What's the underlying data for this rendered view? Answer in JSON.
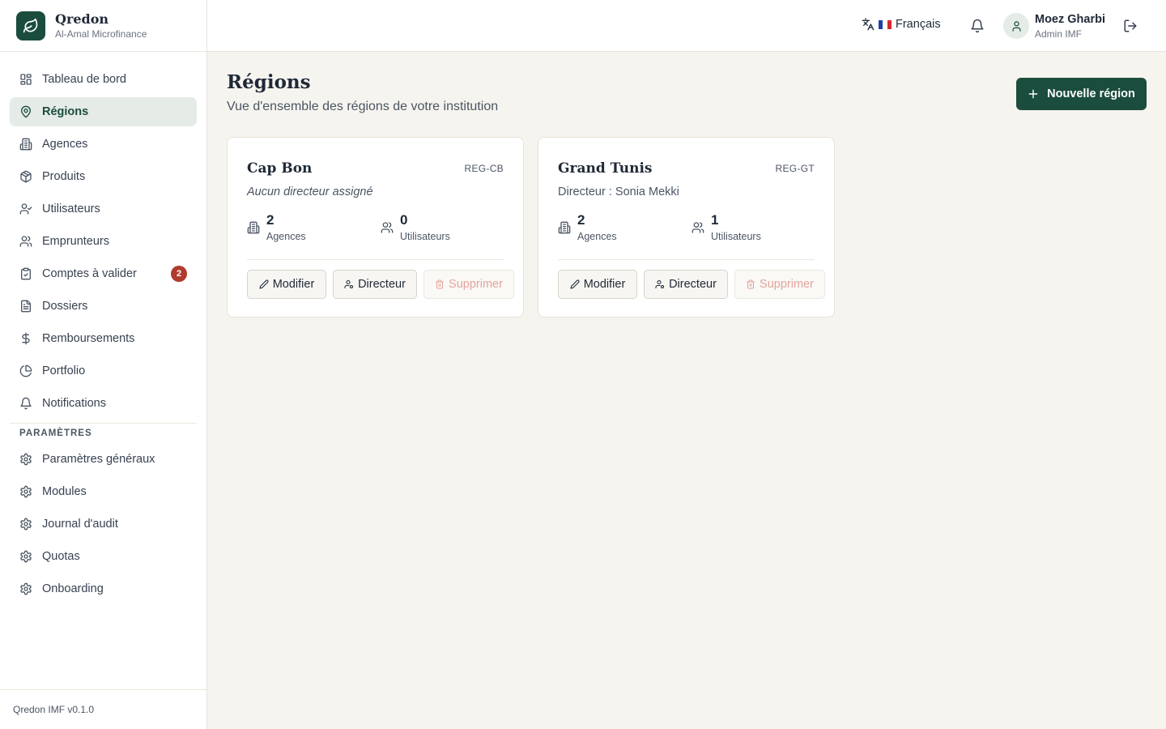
{
  "brand": {
    "name": "Qredon",
    "subtitle": "Al-Amal Microfinance"
  },
  "sidebar": {
    "items": [
      {
        "label": "Tableau de bord",
        "icon": "dashboard-icon"
      },
      {
        "label": "Régions",
        "icon": "map-pin-icon",
        "active": true
      },
      {
        "label": "Agences",
        "icon": "building-icon"
      },
      {
        "label": "Produits",
        "icon": "package-icon"
      },
      {
        "label": "Utilisateurs",
        "icon": "user-check-icon"
      },
      {
        "label": "Emprunteurs",
        "icon": "users-icon"
      },
      {
        "label": "Comptes à valider",
        "icon": "clipboard-icon",
        "badge": "2"
      },
      {
        "label": "Dossiers",
        "icon": "file-icon"
      },
      {
        "label": "Remboursements",
        "icon": "dollar-icon"
      },
      {
        "label": "Portfolio",
        "icon": "pie-chart-icon"
      },
      {
        "label": "Notifications",
        "icon": "bell-icon"
      }
    ],
    "settings_title": "PARAMÈTRES",
    "settings_items": [
      {
        "label": "Paramètres généraux",
        "icon": "gear-icon"
      },
      {
        "label": "Modules",
        "icon": "gear-icon"
      },
      {
        "label": "Journal d'audit",
        "icon": "gear-icon"
      },
      {
        "label": "Quotas",
        "icon": "gear-icon"
      },
      {
        "label": "Onboarding",
        "icon": "gear-icon"
      }
    ],
    "footer": "Qredon IMF v0.1.0"
  },
  "header": {
    "language": "Français",
    "user_name": "Moez Gharbi",
    "user_role": "Admin IMF"
  },
  "page": {
    "title": "Régions",
    "subtitle": "Vue d'ensemble des régions de votre institution",
    "new_button": "Nouvelle région"
  },
  "regions": [
    {
      "name": "Cap Bon",
      "code": "REG-CB",
      "director": "Aucun directeur assigné",
      "agences_count": "2",
      "agences_label": "Agences",
      "users_count": "0",
      "users_label": "Utilisateurs",
      "edit_label": "Modifier",
      "director_label": "Directeur",
      "delete_label": "Supprimer"
    },
    {
      "name": "Grand Tunis",
      "code": "REG-GT",
      "director": "Directeur : Sonia Mekki",
      "agences_count": "2",
      "agences_label": "Agences",
      "users_count": "1",
      "users_label": "Utilisateurs",
      "edit_label": "Modifier",
      "director_label": "Directeur",
      "delete_label": "Supprimer"
    }
  ],
  "colors": {
    "brand": "#1b4d3e",
    "badge": "#b03a2e",
    "background": "#f6f4ef"
  }
}
